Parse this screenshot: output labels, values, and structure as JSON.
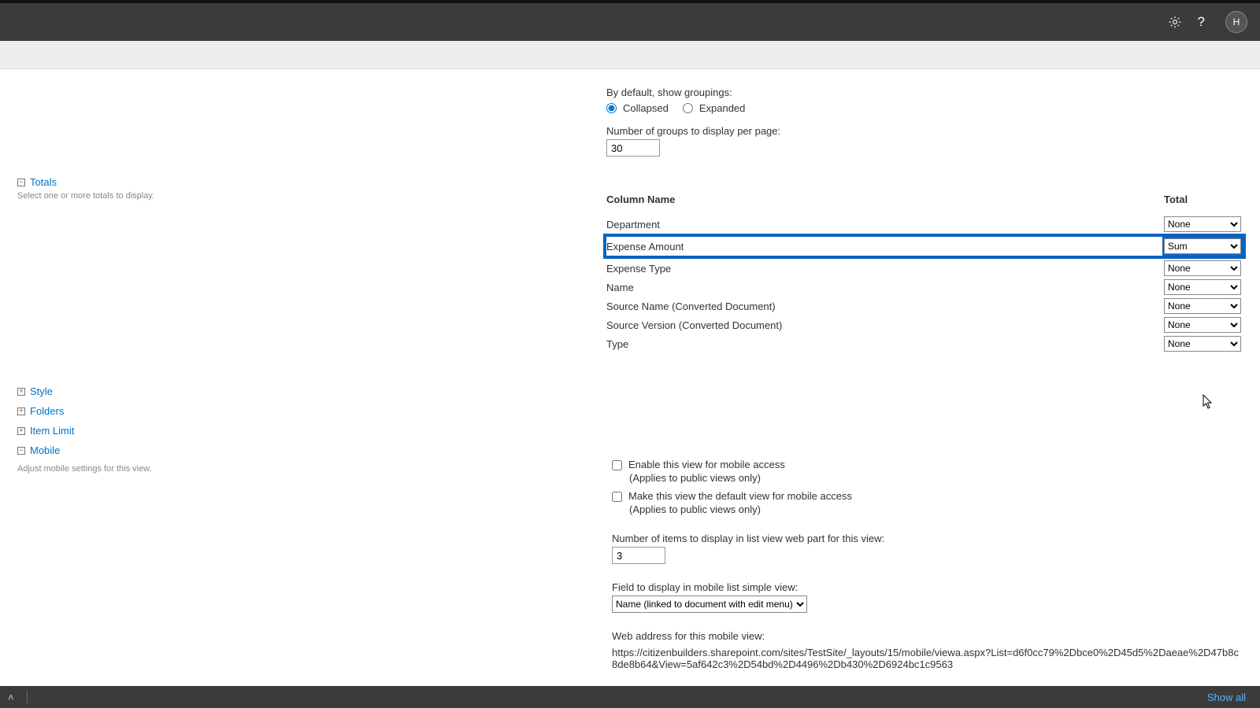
{
  "header": {
    "avatar_label": "H"
  },
  "groupings": {
    "label": "By default, show groupings:",
    "collapsed": "Collapsed",
    "expanded": "Expanded",
    "num_label": "Number of groups to display per page:",
    "num_value": "30"
  },
  "sections": {
    "totals": {
      "title": "Totals",
      "desc": "Select one or more totals to display."
    },
    "style": "Style",
    "folders": "Folders",
    "item_limit": "Item Limit",
    "mobile": {
      "title": "Mobile",
      "desc": "Adjust mobile settings for this view."
    }
  },
  "totals_table": {
    "h1": "Column Name",
    "h2": "Total",
    "rows": [
      {
        "name": "Department",
        "value": "None"
      },
      {
        "name": "Expense Amount",
        "value": "Sum"
      },
      {
        "name": "Expense Type",
        "value": "None"
      },
      {
        "name": "Name",
        "value": "None"
      },
      {
        "name": "Source Name (Converted Document)",
        "value": "None"
      },
      {
        "name": "Source Version (Converted Document)",
        "value": "None"
      },
      {
        "name": "Type",
        "value": "None"
      }
    ]
  },
  "mobile": {
    "enable": "Enable this view for mobile access",
    "applies": "(Applies to public views only)",
    "make_default": "Make this view the default view for mobile access",
    "items_label": "Number of items to display in list view web part for this view:",
    "items_value": "3",
    "field_label": "Field to display in mobile list simple view:",
    "field_value": "Name (linked to document with edit menu)",
    "url_label": "Web address for this mobile view:",
    "url": "https://citizenbuilders.sharepoint.com/sites/TestSite/_layouts/15/mobile/viewa.aspx?List=d6f0cc79%2Dbce0%2D45d5%2Daeae%2D47b8c8de8b64&View=5af642c3%2D54bd%2D4496%2Db430%2D6924bc1c9563"
  },
  "bottom": {
    "show_all": "Show all"
  }
}
